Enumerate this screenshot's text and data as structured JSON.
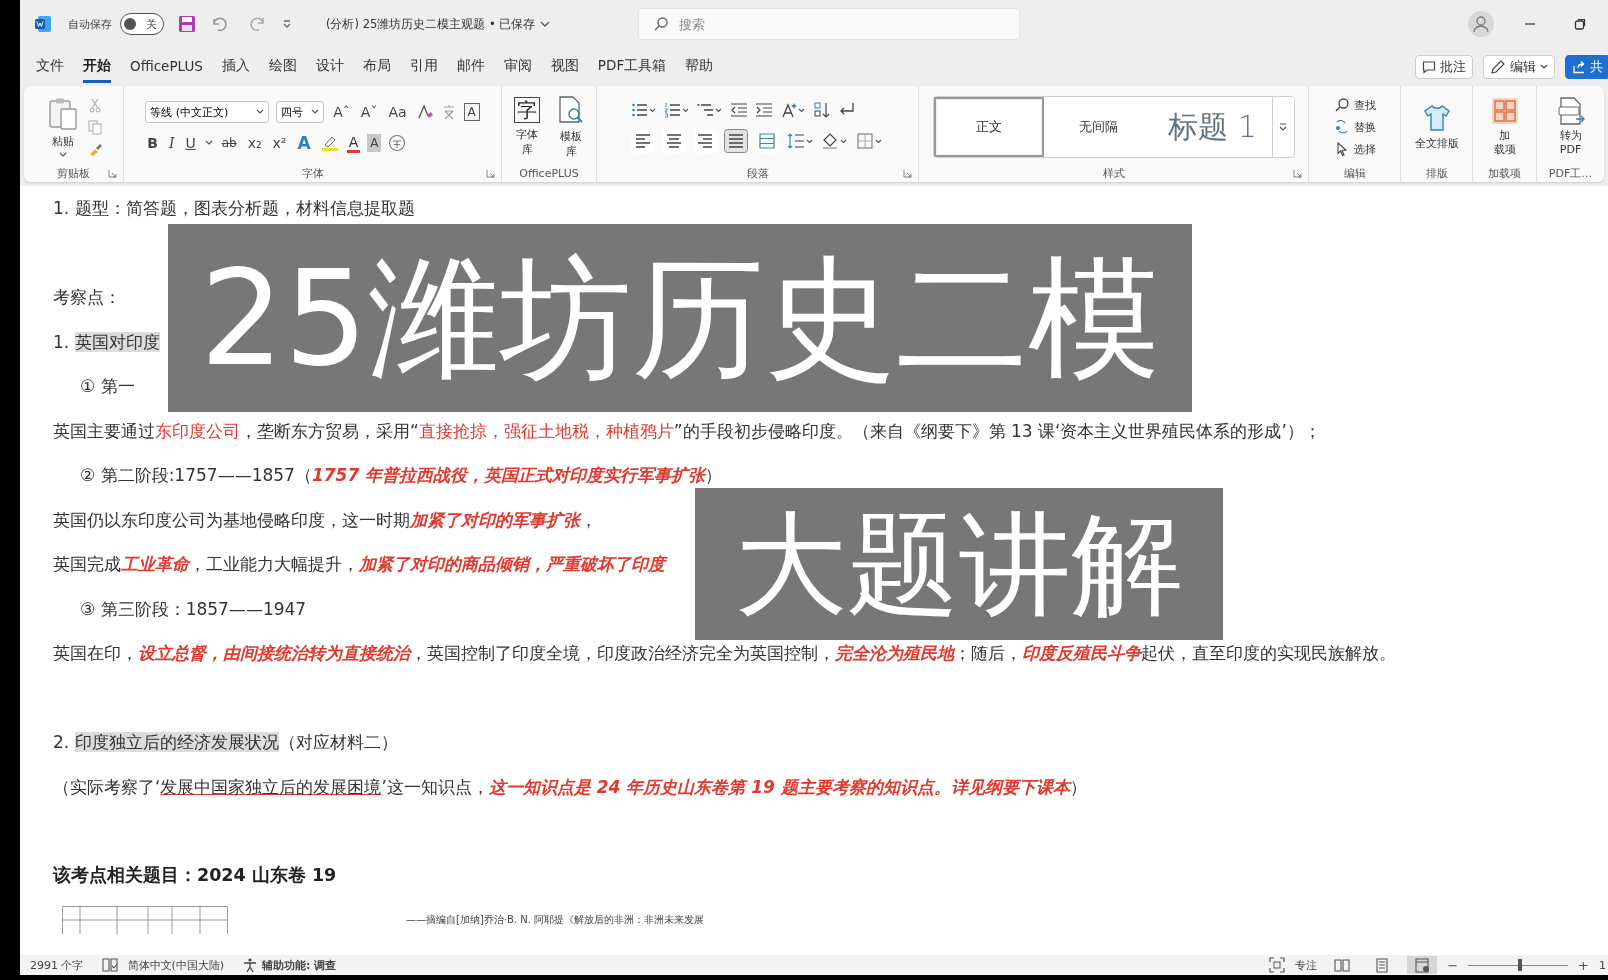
{
  "title_bar": {
    "autosave_label": "自动保存",
    "autosave": {
      "on": false,
      "label": "关"
    },
    "document_title": "(分析) 25潍坊历史二模主观题 • 已保存",
    "search": {
      "placeholder": "搜索"
    }
  },
  "tabs": [
    {
      "label": "文件",
      "selected": false
    },
    {
      "label": "开始",
      "selected": true
    },
    {
      "label": "OfficePLUS",
      "selected": false
    },
    {
      "label": "插入",
      "selected": false
    },
    {
      "label": "绘图",
      "selected": false
    },
    {
      "label": "设计",
      "selected": false
    },
    {
      "label": "布局",
      "selected": false
    },
    {
      "label": "引用",
      "selected": false
    },
    {
      "label": "邮件",
      "selected": false
    },
    {
      "label": "审阅",
      "selected": false
    },
    {
      "label": "视图",
      "selected": false
    },
    {
      "label": "PDF工具箱",
      "selected": false
    },
    {
      "label": "帮助",
      "selected": false
    }
  ],
  "actions": [
    {
      "label": "批注",
      "kind": "comment"
    },
    {
      "label": "编辑",
      "kind": "editing"
    },
    {
      "label": "共",
      "kind": "share"
    }
  ],
  "ribbon": {
    "groups": [
      {
        "kind": "clipboard",
        "label": "剪贴板",
        "paste_label": "粘贴"
      },
      {
        "kind": "font",
        "label": "字体",
        "font_name": "等线 (中文正文)",
        "font_size": "四号",
        "size_buttons": [
          "Aˆ",
          "Aˇ"
        ],
        "case_button": "Aa",
        "border_button": "A",
        "format_buttons": [
          "B",
          "I",
          "U"
        ],
        "strike_button": "ab",
        "script_buttons": [
          "x₂",
          "x²"
        ],
        "effect_button": "A",
        "color_button": "A",
        "shade_button": "A"
      },
      {
        "kind": "officeplus",
        "label": "OfficePLUS",
        "buttons": [
          {
            "label": "字体库",
            "glyph": "字"
          },
          {
            "label": "模板库"
          }
        ]
      },
      {
        "kind": "paragraph",
        "label": "段落",
        "alignments": [
          {
            "selected": false
          },
          {
            "selected": false
          },
          {
            "selected": false
          },
          {
            "selected": true
          },
          {
            "selected": false
          }
        ]
      },
      {
        "kind": "styles",
        "label": "样式",
        "items": [
          {
            "label": "正文",
            "kind": "normal",
            "selected": true
          },
          {
            "label": "无间隔",
            "kind": "normal",
            "selected": false
          },
          {
            "label": "标题 1",
            "kind": "heading",
            "selected": false
          }
        ]
      },
      {
        "kind": "editing",
        "label": "编辑",
        "items": [
          "查找",
          "替换",
          "选择"
        ]
      },
      {
        "kind": "layout",
        "label": "排版",
        "button": "全文排版"
      },
      {
        "kind": "addins",
        "label": "加载项",
        "button_lines": [
          "加",
          "载项"
        ]
      },
      {
        "kind": "pdf",
        "label": "PDF工…",
        "button_lines": [
          "转为",
          "PDF"
        ]
      }
    ]
  },
  "document": {
    "sections": [
      {
        "lines": [
          {
            "kind": "para",
            "segments": [
              {
                "text": "1. 题型：简答题，图表分析题，材料信息提取题",
                "kind": "plain"
              }
            ]
          }
        ]
      },
      {
        "lines": [
          {
            "kind": "para",
            "segments": [
              {
                "text": "考察点：",
                "kind": "plain"
              }
            ]
          },
          {
            "kind": "para",
            "segments": [
              {
                "text": "1. ",
                "kind": "plain"
              },
              {
                "text": "英国对印度",
                "kind": "highlight"
              }
            ]
          },
          {
            "kind": "item",
            "segments": [
              {
                "text": "① 第一",
                "kind": "plain"
              }
            ]
          },
          {
            "kind": "para",
            "segments": [
              {
                "text": "英国主要通过",
                "kind": "plain"
              },
              {
                "text": "东印度公司",
                "kind": "red"
              },
              {
                "text": "，垄断东方贸易，采用“",
                "kind": "plain"
              },
              {
                "text": "直接抢掠，强征土地税，种植鸦片",
                "kind": "red"
              },
              {
                "text": "”的手段初步侵略印度。（来自《纲要下》第 13 课‘资本主义世界殖民体系的形成’）；",
                "kind": "plain"
              }
            ]
          },
          {
            "kind": "item",
            "segments": [
              {
                "text": "② 第二阶段:1757——1857（",
                "kind": "plain"
              },
              {
                "text": "1757 年普拉西战役，英国正式对印度实行军事扩张",
                "kind": "red-bi"
              },
              {
                "text": "）",
                "kind": "plain"
              }
            ]
          },
          {
            "kind": "para",
            "segments": [
              {
                "text": "英国仍以东印度公司为基地侵略印度，这一时期",
                "kind": "plain"
              },
              {
                "text": "加紧了对印的军事扩张",
                "kind": "red-bi"
              },
              {
                "text": "，",
                "kind": "plain"
              }
            ]
          },
          {
            "kind": "para",
            "segments": [
              {
                "text": "英国完成",
                "kind": "plain"
              },
              {
                "text": "工业革命",
                "kind": "red-bi"
              },
              {
                "text": "，工业能力大幅提升，",
                "kind": "plain"
              },
              {
                "text": "加紧了对印的商品倾销，严重破坏了印度",
                "kind": "red-bi"
              }
            ]
          },
          {
            "kind": "item",
            "segments": [
              {
                "text": "③ 第三阶段：1857——1947",
                "kind": "plain"
              }
            ]
          },
          {
            "kind": "para",
            "segments": [
              {
                "text": "英国在印，",
                "kind": "plain"
              },
              {
                "text": "设立总督，由间接统治转为直接统治",
                "kind": "red-bi"
              },
              {
                "text": "，英国控制了印度全境，印度政治经济完全为英国控制，",
                "kind": "plain"
              },
              {
                "text": "完全沦为殖民地",
                "kind": "red-bi"
              },
              {
                "text": "；随后，",
                "kind": "plain"
              },
              {
                "text": "印度反殖民斗争",
                "kind": "red-bi"
              },
              {
                "text": "起伏，直至印度的实现民族解放。",
                "kind": "plain"
              }
            ]
          }
        ]
      },
      {
        "lines": [
          {
            "kind": "para",
            "segments": [
              {
                "text": "2. ",
                "kind": "plain"
              },
              {
                "text": "印度独立后的经济发展状况",
                "kind": "highlight"
              },
              {
                "text": "（对应材料二）",
                "kind": "plain"
              }
            ]
          },
          {
            "kind": "para",
            "segments": [
              {
                "text": "（实际考察了‘",
                "kind": "plain"
              },
              {
                "text": "发展中国家独立后的发展困境",
                "kind": "underline"
              },
              {
                "text": "’这一知识点，",
                "kind": "plain"
              },
              {
                "text": "这一知识点是 24 年历史山东卷第 19 题主要考察的知识点。详见纲要下课本",
                "kind": "red-bi"
              },
              {
                "text": "）",
                "kind": "plain"
              }
            ]
          }
        ]
      },
      {
        "lines": [
          {
            "kind": "heading",
            "segments": [
              {
                "text": "该考点相关题目：2024 山东卷 19",
                "kind": "plain"
              }
            ]
          },
          {
            "kind": "figure",
            "citation": "——摘编自[加纳]乔治·B. N. 阿耶提《解放后的非洲：非洲未来发展"
          }
        ]
      }
    ]
  },
  "overlay_captions": [
    {
      "text": "25潍坊历史二模",
      "kind": "title"
    },
    {
      "text": "大题讲解",
      "kind": "subtitle"
    }
  ],
  "status_bar": {
    "word_count": "2991 个字",
    "language": "简体中文(中国大陆)",
    "accessibility": "辅助功能: 调查",
    "focus": "专注",
    "views": [
      {
        "selected": false
      },
      {
        "selected": false
      },
      {
        "selected": true
      }
    ],
    "zoom_out": "−",
    "zoom": {
      "level": 0.52
    },
    "zoom_in": "+",
    "zoom_percent": "1"
  }
}
